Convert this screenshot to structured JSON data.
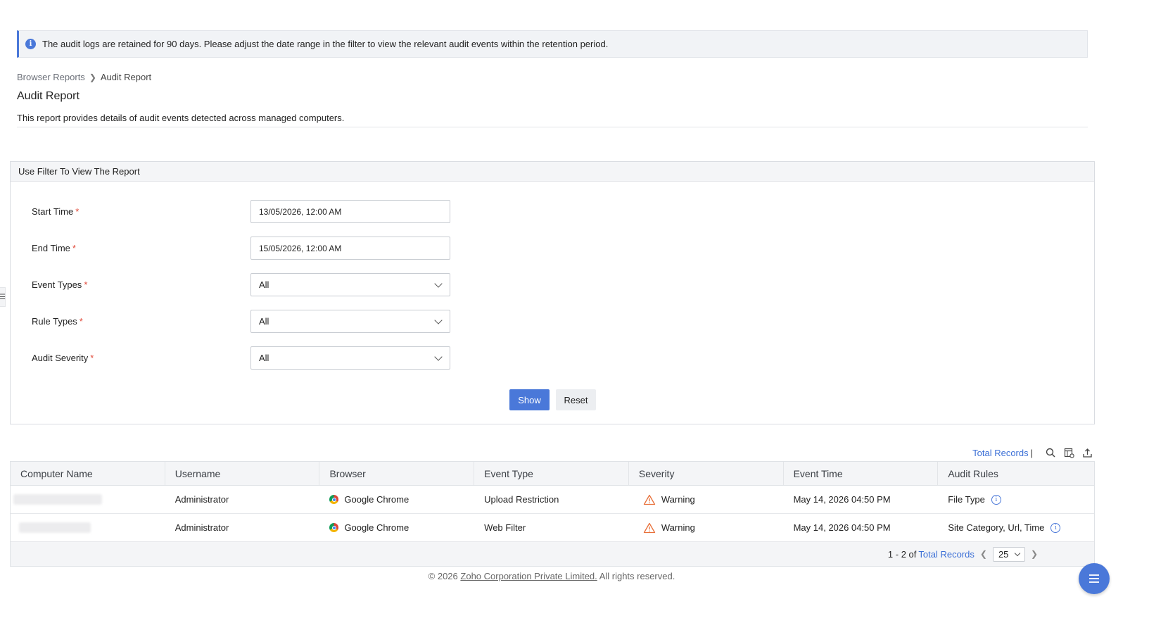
{
  "banner": {
    "icon": "info-icon",
    "message": "The audit logs are retained for 90 days. Please adjust the date range in the filter to view the relevant audit events within the retention period."
  },
  "breadcrumb": {
    "parent": "Browser Reports",
    "current": "Audit Report"
  },
  "page": {
    "title": "Audit Report",
    "description": "This report provides details of audit events detected across managed computers."
  },
  "filter": {
    "heading": "Use Filter To View The Report",
    "fields": [
      {
        "label": "Start Time",
        "value": "13/05/2026, 12:00 AM"
      },
      {
        "label": "End Time",
        "value": "15/05/2026, 12:00 AM"
      },
      {
        "label": "Event Types",
        "value": "All"
      },
      {
        "label": "Rule Types",
        "value": "All"
      },
      {
        "label": "Audit Severity",
        "value": "All"
      }
    ],
    "required_mark": "*",
    "show_label": "Show",
    "reset_label": "Reset"
  },
  "toolbar": {
    "total_records_label": "Total Records",
    "separator": "|",
    "icons": [
      "search-icon",
      "column-settings-icon",
      "export-icon"
    ]
  },
  "table": {
    "columns": [
      "Computer Name",
      "Username",
      "Browser",
      "Event Type",
      "Severity",
      "Event Time",
      "Audit Rules"
    ],
    "rows": [
      {
        "computer": "",
        "username": "Administrator",
        "browser": "Google Chrome",
        "event_type": "Upload Restriction",
        "severity": "Warning",
        "event_time": "May 14, 2026 04:50 PM",
        "audit_rules": "File Type"
      },
      {
        "computer": "",
        "username": "Administrator",
        "browser": "Google Chrome",
        "event_type": "Web Filter",
        "severity": "Warning",
        "event_time": "May 14, 2026 04:50 PM",
        "audit_rules": "Site Category, Url, Time"
      }
    ]
  },
  "pagination": {
    "range": "1 - 2 of",
    "total_label": "Total Records",
    "page_size": "25"
  },
  "footer": {
    "prefix": "© 2026",
    "company": "Zoho Corporation Private Limited.",
    "suffix": "All rights reserved."
  },
  "colors": {
    "accent": "#4a78d9",
    "link": "#3b6fd6",
    "warning": "#e8703a",
    "required": "#e14a3a"
  }
}
